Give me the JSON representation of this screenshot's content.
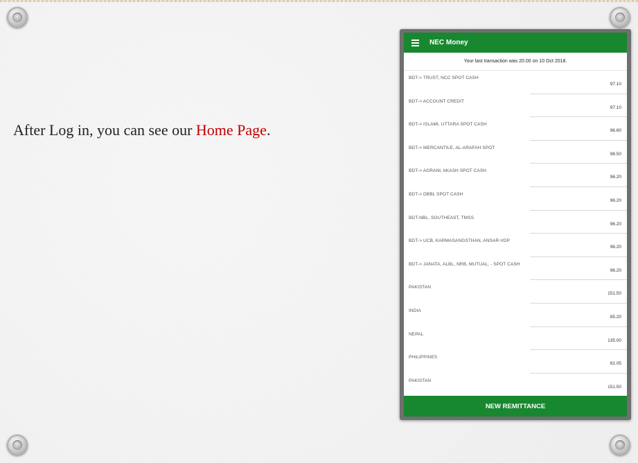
{
  "slide": {
    "caption_prefix": "After Log in, you can see our ",
    "caption_highlight": "Home Page",
    "caption_suffix": ".",
    "highlight_color": "#c00000"
  },
  "app": {
    "title": "NEC Money",
    "accent_color": "#17882f",
    "menu_icon": "hamburger-menu-icon",
    "last_transaction": "Your last transaction was 20.00 on 10 Oct 2018.",
    "rates": [
      {
        "name": "BDT-> TRUST, NCC SPOT CASH",
        "rate": "97.10"
      },
      {
        "name": "BDT-> ACCOUNT CREDIT",
        "rate": "97.10"
      },
      {
        "name": "BDT-> ISLAMI, UTTARA SPOT CASH",
        "rate": "96.60"
      },
      {
        "name": "BDT-> MERCANTILE, AL-ARAFAH SPOT",
        "rate": "96.50"
      },
      {
        "name": "BDT-> AGRANI, bKASH SPOT CASH",
        "rate": "96.20"
      },
      {
        "name": "BDT-> DBBL SPOT CASH",
        "rate": "96.20"
      },
      {
        "name": "BDT-NBL, SOUTHEAST, TMSS",
        "rate": "96.20"
      },
      {
        "name": "BDT-> UCB, KARMASANGSTHAN, ANSAR-VDP",
        "rate": "96.20"
      },
      {
        "name": "BDT-> JANATA, ALBL, NRB, MUTUAL, - SPOT CASH",
        "rate": "96.20"
      },
      {
        "name": "PAKISTAN",
        "rate": "151.50"
      },
      {
        "name": "INDIA",
        "rate": "85.20"
      },
      {
        "name": "NEPAL",
        "rate": "135.00"
      },
      {
        "name": "PHILIPPINES",
        "rate": "62.05"
      },
      {
        "name": "PAKISTAN",
        "rate": "151.50"
      }
    ],
    "new_remittance_label": "NEW REMITTANCE"
  }
}
